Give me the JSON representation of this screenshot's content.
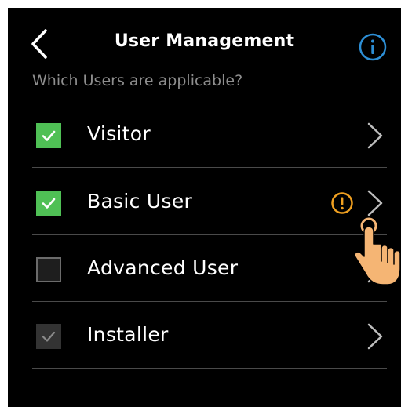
{
  "header": {
    "title": "User Management",
    "back_icon": "chevron-left-icon",
    "info_icon": "info-icon"
  },
  "question": "Which Users are applicable?",
  "users": [
    {
      "label": "Visitor",
      "state": "checked",
      "warning": false
    },
    {
      "label": "Basic User",
      "state": "checked",
      "warning": true
    },
    {
      "label": "Advanced User",
      "state": "unchecked",
      "warning": false
    },
    {
      "label": "Installer",
      "state": "checked-disabled",
      "warning": false
    }
  ],
  "colors": {
    "background": "#000000",
    "check_green": "#4fc055",
    "info_blue": "#2d8fd6",
    "warning_orange": "#f0a020",
    "hand_skin": "#f5b574"
  }
}
